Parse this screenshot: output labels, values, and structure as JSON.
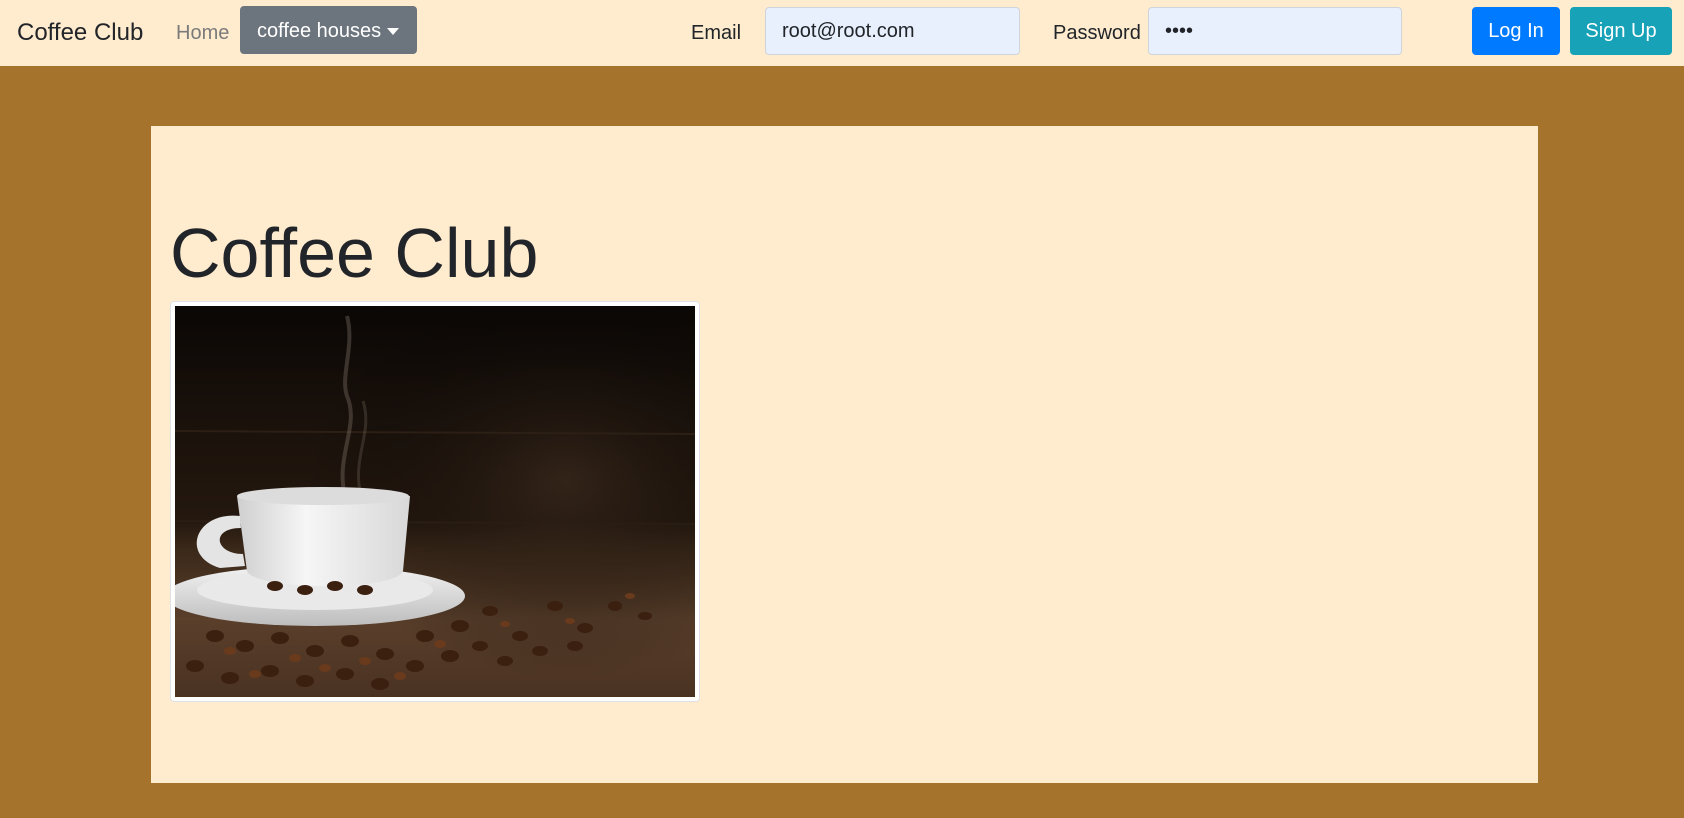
{
  "navbar": {
    "brand": "Coffee Club",
    "home_link": "Home",
    "dropdown_label": "coffee houses",
    "email_label": "Email",
    "email_value": "root@root.com",
    "password_label": "Password",
    "password_value": "root",
    "login_label": "Log In",
    "signup_label": "Sign Up"
  },
  "main": {
    "title": "Coffee Club"
  },
  "colors": {
    "page_background": "#a5732b",
    "navbar_background": "#ffebcd",
    "jumbotron_background": "#ffebcd",
    "dropdown_button": "#6c757d",
    "login_button": "#007bff",
    "signup_button": "#17a2b8",
    "autofill_field": "#e8f0fe"
  }
}
